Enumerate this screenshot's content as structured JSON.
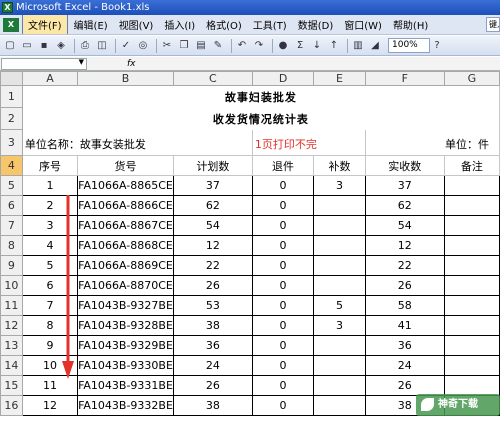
{
  "window": {
    "title": "Microsoft Excel - Book1.xls"
  },
  "menu": {
    "items": [
      "文件(F)",
      "编辑(E)",
      "视图(V)",
      "插入(I)",
      "格式(O)",
      "工具(T)",
      "数据(D)",
      "窗口(W)",
      "帮助(H)"
    ],
    "help_box": "键入"
  },
  "toolbar": {
    "zoom": "100%",
    "sigma": "Σ"
  },
  "formula_bar": {
    "name_box": "",
    "fx": "fx"
  },
  "columns": [
    "A",
    "B",
    "C",
    "D",
    "E",
    "F",
    "G"
  ],
  "row_numbers": [
    "1",
    "2",
    "3",
    "4",
    "5",
    "6",
    "7",
    "8",
    "9",
    "10",
    "11",
    "12",
    "13",
    "14",
    "15",
    "16"
  ],
  "sheet": {
    "title1": "故事妇装批发",
    "title2": "收发货情况统计表",
    "unit_name": "单位名称：故事女装批发",
    "print_note": "1页打印不完",
    "unit": "单位：件",
    "headers": [
      "序号",
      "货号",
      "计划数",
      "退件",
      "补数",
      "实收数",
      "备注"
    ],
    "rows": [
      [
        "1",
        "FA1066A-8865CE",
        "37",
        "0",
        "3",
        "37",
        ""
      ],
      [
        "2",
        "FA1066A-8866CE",
        "62",
        "0",
        "",
        "62",
        ""
      ],
      [
        "3",
        "FA1066A-8867CE",
        "54",
        "0",
        "",
        "54",
        ""
      ],
      [
        "4",
        "FA1066A-8868CE",
        "12",
        "0",
        "",
        "12",
        ""
      ],
      [
        "5",
        "FA1066A-8869CE",
        "22",
        "0",
        "",
        "22",
        ""
      ],
      [
        "6",
        "FA1066A-8870CE",
        "26",
        "0",
        "",
        "26",
        ""
      ],
      [
        "7",
        "FA1043B-9327BE",
        "53",
        "0",
        "5",
        "58",
        ""
      ],
      [
        "8",
        "FA1043B-9328BE",
        "38",
        "0",
        "3",
        "41",
        ""
      ],
      [
        "9",
        "FA1043B-9329BE",
        "36",
        "0",
        "",
        "36",
        ""
      ],
      [
        "10",
        "FA1043B-9330BE",
        "24",
        "0",
        "",
        "24",
        ""
      ],
      [
        "11",
        "FA1043B-9331BE",
        "26",
        "0",
        "",
        "26",
        ""
      ],
      [
        "12",
        "FA1043B-9332BE",
        "38",
        "0",
        "",
        "38",
        ""
      ]
    ]
  },
  "watermark": "神奇下载",
  "colors": {
    "arrow": "#e3312b",
    "selected_row_header": "#f7c66a",
    "print_note": "#e3312b"
  }
}
